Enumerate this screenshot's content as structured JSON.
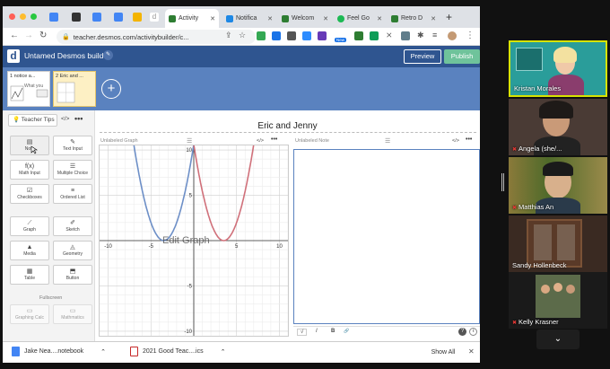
{
  "browser": {
    "tabs": [
      {
        "label": "",
        "color": "#4285f4"
      },
      {
        "label": "",
        "color": "#333333"
      },
      {
        "label": "",
        "color": "#4285f4"
      },
      {
        "label": "",
        "color": "#f4b400"
      },
      {
        "label": "d",
        "color": "#aaaaaa"
      },
      {
        "label": "Activity",
        "color": "#2e7d32",
        "active": true
      },
      {
        "label": "Notifica",
        "color": "#1e88e5"
      },
      {
        "label": "Welcom",
        "color": "#2e7d32"
      },
      {
        "label": "Feel Go",
        "color": "#1db954"
      },
      {
        "label": "Retro D",
        "color": "#2e7d32"
      }
    ],
    "url": "teacher.desmos.com/activitybuilder/c...",
    "new_badge": "New"
  },
  "desmos": {
    "logo": "d",
    "title": "Untamed Desmos build",
    "preview_label": "Preview",
    "publish_label": "Publish",
    "screens": [
      {
        "label": "1 notice a...",
        "sub": "What you"
      },
      {
        "label": "2 Eric and ...",
        "sub": ""
      }
    ],
    "add_screen": "+",
    "teacher_tips": "Teacher Tips",
    "components": [
      {
        "label": "Note",
        "glyph": "▤"
      },
      {
        "label": "Text Input",
        "glyph": "✎"
      },
      {
        "label": "Math Input",
        "glyph": "f(x)"
      },
      {
        "label": "Multiple Choice",
        "glyph": "☰"
      },
      {
        "label": "Checkboxes",
        "glyph": "☑"
      },
      {
        "label": "Ordered List",
        "glyph": "≡"
      },
      {
        "label": "Graph",
        "glyph": "⟋"
      },
      {
        "label": "Sketch",
        "glyph": "✐"
      },
      {
        "label": "Media",
        "glyph": "▲"
      },
      {
        "label": "Geometry",
        "glyph": "◬"
      },
      {
        "label": "Table",
        "glyph": "▦"
      },
      {
        "label": "Button",
        "glyph": "⬒"
      },
      {
        "label": "Graphing Calc",
        "glyph": ""
      },
      {
        "label": "Mathmatics",
        "glyph": ""
      }
    ],
    "fullscreen_label": "Fullscreen",
    "screen_title": "Eric and Jenny",
    "graph_panel_title": "Unlabeled Graph",
    "note_panel_title": "Unlabeled Note",
    "edit_graph_label": "Edit Graph",
    "x_ticks": [
      "-10",
      "-5",
      "5",
      "10"
    ],
    "y_ticks": [
      "10",
      "5",
      "-5",
      "-10"
    ],
    "note_tools": [
      "√",
      "I",
      "B",
      "🔗"
    ]
  },
  "downloads": {
    "items": [
      "Jake Nea....notebook",
      "2021 Good Teac....ics"
    ],
    "show_all": "Show All"
  },
  "zoom": {
    "participants": [
      {
        "name": "Kristan Morales",
        "bg": "#2a9d9a",
        "muted": false
      },
      {
        "name": "Angela (she/...",
        "bg": "#4a3b35",
        "muted": true
      },
      {
        "name": "Matthias An",
        "bg": "#7a6a3a",
        "muted": true
      },
      {
        "name": "Sandy Hollenbeck",
        "bg": "#3a2a22",
        "muted": false
      },
      {
        "name": "Kelly Krasner",
        "bg": "#5c6b4a",
        "muted": true
      }
    ],
    "chevron": "⌄"
  }
}
